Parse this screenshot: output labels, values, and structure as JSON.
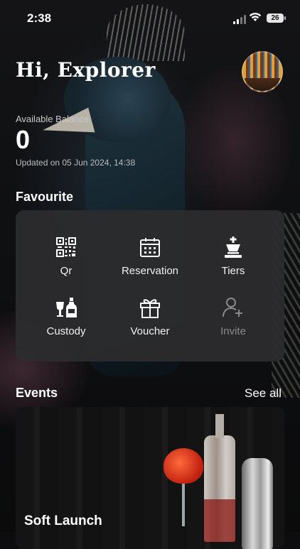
{
  "status_bar": {
    "time": "2:38",
    "battery": "26"
  },
  "header": {
    "greeting": "Hi, Explorer"
  },
  "balance": {
    "label": "Available Balance",
    "value": "0",
    "updated": "Updated on 05 Jun 2024, 14:38"
  },
  "favourite": {
    "title": "Favourite",
    "items": [
      {
        "label": "Qr",
        "icon": "qr-code-icon",
        "enabled": true
      },
      {
        "label": "Reservation",
        "icon": "calendar-icon",
        "enabled": true
      },
      {
        "label": "Tiers",
        "icon": "chess-king-icon",
        "enabled": true
      },
      {
        "label": "Custody",
        "icon": "bottles-icon",
        "enabled": true
      },
      {
        "label": "Voucher",
        "icon": "gift-icon",
        "enabled": true
      },
      {
        "label": "Invite",
        "icon": "add-user-icon",
        "enabled": false
      }
    ]
  },
  "events": {
    "title": "Events",
    "see_all": "See all",
    "cards": [
      {
        "title": "Soft Launch"
      }
    ]
  },
  "colors": {
    "card_bg": "#2c2c2e",
    "disabled_text": "#8a8a8a"
  }
}
